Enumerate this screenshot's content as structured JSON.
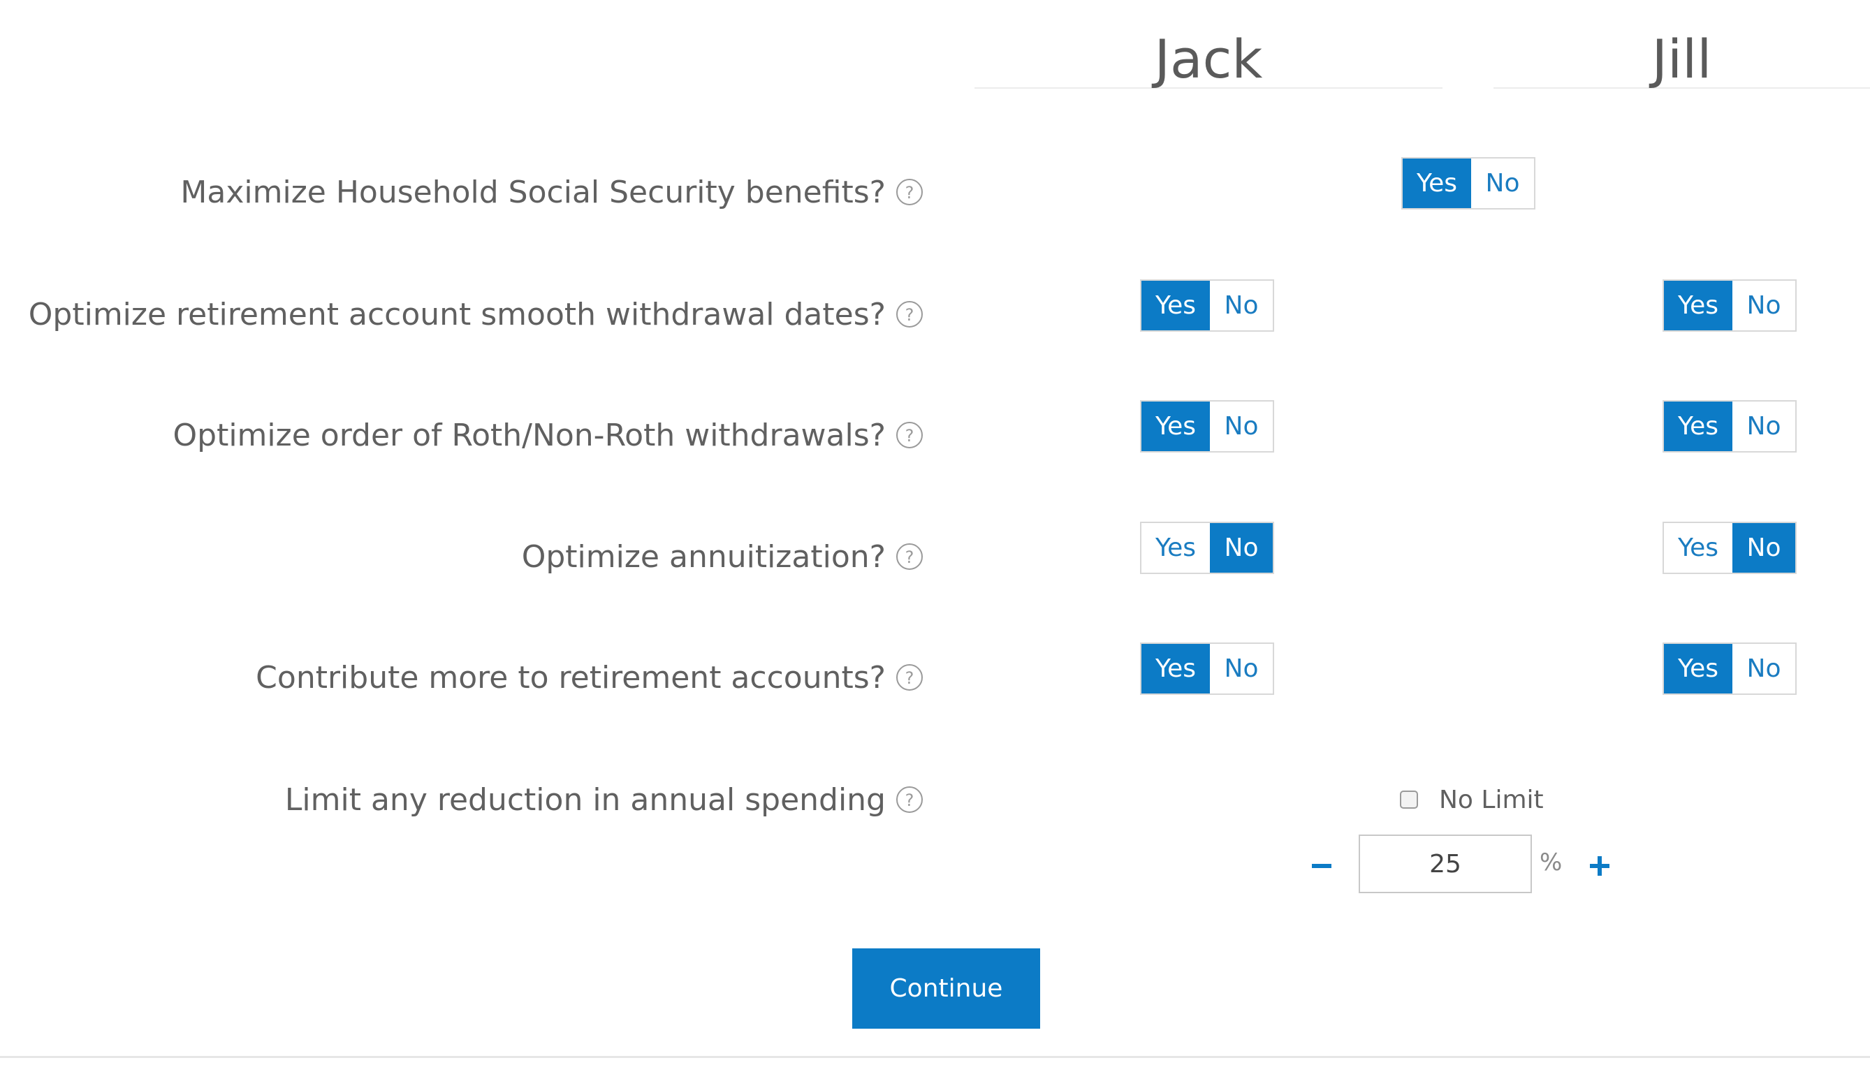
{
  "people": {
    "jack": "Jack",
    "jill": "Jill"
  },
  "colors": {
    "accent": "#0c7bc6",
    "text": "#606060"
  },
  "questions": [
    {
      "label": "Maximize Household Social Security benefits?",
      "shared": {
        "yes": "Yes",
        "no": "No",
        "selected": "Yes"
      }
    },
    {
      "label": "Optimize retirement account smooth withdrawal dates?",
      "jack": {
        "yes": "Yes",
        "no": "No",
        "selected": "Yes"
      },
      "jill": {
        "yes": "Yes",
        "no": "No",
        "selected": "Yes"
      }
    },
    {
      "label": "Optimize order of Roth/Non-Roth withdrawals?",
      "jack": {
        "yes": "Yes",
        "no": "No",
        "selected": "Yes"
      },
      "jill": {
        "yes": "Yes",
        "no": "No",
        "selected": "Yes"
      }
    },
    {
      "label": "Optimize annuitization?",
      "jack": {
        "yes": "Yes",
        "no": "No",
        "selected": "No"
      },
      "jill": {
        "yes": "Yes",
        "no": "No",
        "selected": "No"
      }
    },
    {
      "label": "Contribute more to retirement accounts?",
      "jack": {
        "yes": "Yes",
        "no": "No",
        "selected": "Yes"
      },
      "jill": {
        "yes": "Yes",
        "no": "No",
        "selected": "Yes"
      }
    },
    {
      "label": "Limit any reduction in annual spending"
    }
  ],
  "spending_limit": {
    "no_limit_label": "No Limit",
    "no_limit_checked": false,
    "value": "25",
    "unit": "%"
  },
  "continue_label": "Continue",
  "icons": {
    "help": "question-circle-icon",
    "minus": "minus-icon",
    "plus": "plus-icon"
  }
}
